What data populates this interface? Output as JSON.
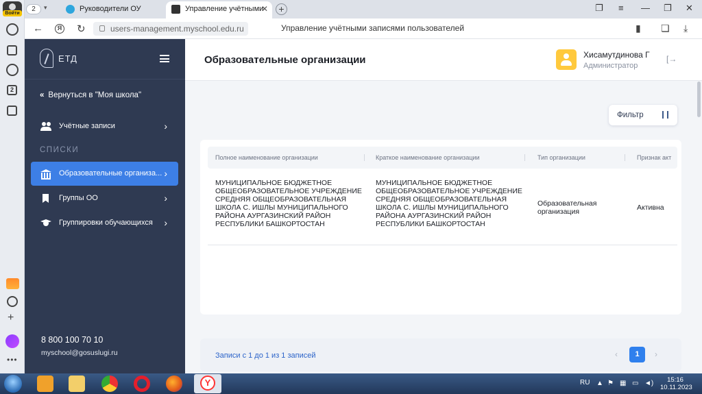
{
  "browser": {
    "login_label": "Войти",
    "tab_count": "2",
    "tabs": [
      {
        "title": "Руководители ОУ"
      },
      {
        "title": "Управление учётными"
      }
    ],
    "url": "users-management.myschool.edu.ru",
    "page_title": "Управление учётными записями пользователей",
    "rail_badge": "2"
  },
  "sidebar": {
    "logo_text": "ЕТД",
    "back_label": "Вернуться в \"Моя школа\"",
    "accounts_label": "Учётные записи",
    "lists_heading": "СПИСКИ",
    "items": [
      {
        "label": "Образовательные организа..."
      },
      {
        "label": "Группы ОО"
      },
      {
        "label": "Группировки обучающихся"
      }
    ],
    "phone": "8 800 100 70 10",
    "email": "myschool@gosuslugi.ru"
  },
  "header": {
    "title": "Образовательные организации",
    "user_name": "Хисамутдинова Г",
    "user_role": "Администратор"
  },
  "filter_label": "Фильтр",
  "table": {
    "columns": [
      "Полное наименование организации",
      "Краткое наименование организации",
      "Тип организации",
      "Признак акт"
    ],
    "rows": [
      {
        "full_name": "МУНИЦИПАЛЬНОЕ БЮДЖЕТНОЕ ОБЩЕОБРАЗОВАТЕЛЬНОЕ УЧРЕЖДЕНИЕ СРЕДНЯЯ ОБЩЕОБРАЗОВАТЕЛЬНАЯ ШКОЛА С. ИШЛЫ МУНИЦИПАЛЬНОГО РАЙОНА АУРГАЗИНСКИЙ РАЙОН РЕСПУБЛИКИ БАШКОРТОСТАН",
        "short_name": "МУНИЦИПАЛЬНОЕ БЮДЖЕТНОЕ ОБЩЕОБРАЗОВАТЕЛЬНОЕ УЧРЕЖДЕНИЕ СРЕДНЯЯ ОБЩЕОБРАЗОВАТЕЛЬНАЯ ШКОЛА С. ИШЛЫ МУНИЦИПАЛЬНОГО РАЙОНА АУРГАЗИНСКИЙ РАЙОН РЕСПУБЛИКИ БАШКОРТОСТАН",
        "type": "Образовательная организация",
        "status": "Активна"
      }
    ]
  },
  "pagination": {
    "summary": "Записи с 1 до 1 из 1 записей",
    "current_page": "1"
  },
  "taskbar": {
    "lang": "RU",
    "time": "15:16",
    "date": "10.11.2023"
  },
  "colors": {
    "sidebar_bg": "#2f3a52",
    "active_item": "#3d7fe6",
    "accent": "#2f80ed"
  }
}
